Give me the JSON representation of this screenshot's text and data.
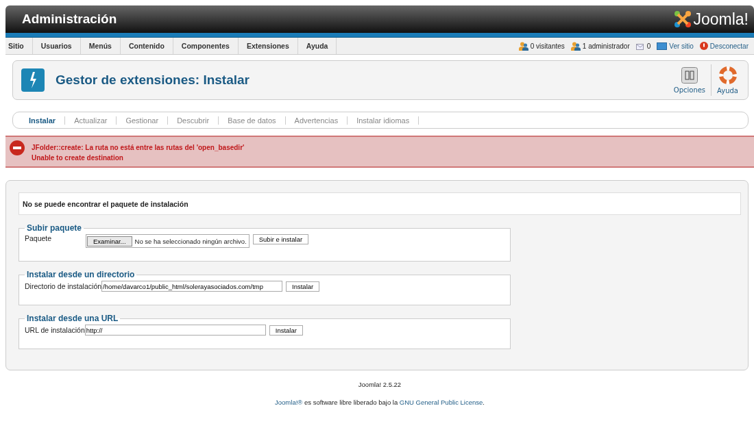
{
  "header": {
    "title": "Administración",
    "logo": "Joomla!"
  },
  "menu": [
    "Sitio",
    "Usuarios",
    "Menús",
    "Contenido",
    "Componentes",
    "Extensiones",
    "Ayuda"
  ],
  "status": [
    {
      "kind": "text",
      "label": "0 visitantes"
    },
    {
      "kind": "text",
      "label": "1 administrador"
    },
    {
      "kind": "text",
      "label": "0"
    },
    {
      "kind": "link",
      "label": "Ver sitio"
    },
    {
      "kind": "link",
      "label": "Desconectar"
    }
  ],
  "toolbar": {
    "title": "Gestor de extensiones: Instalar",
    "buttons": [
      "Opciones",
      "Ayuda"
    ]
  },
  "subtabs": [
    {
      "label": "Instalar",
      "selected": true
    },
    {
      "label": "Actualizar",
      "selected": false
    },
    {
      "label": "Gestionar",
      "selected": false
    },
    {
      "label": "Descubrir",
      "selected": false
    },
    {
      "label": "Base de datos",
      "selected": false
    },
    {
      "label": "Advertencias",
      "selected": false
    },
    {
      "label": "Instalar idiomas",
      "selected": false
    }
  ],
  "error": [
    "JFolder::create: La ruta no está entre las rutas del 'open_basedir'",
    "Unable to create destination"
  ],
  "notice": "No se puede encontrar el paquete de instalación",
  "upload": {
    "legend": "Subir paquete",
    "label": "Paquete",
    "browse": "Examinar...",
    "file_status": "No se ha seleccionado ningún archivo.",
    "button": "Subir e instalar"
  },
  "directory": {
    "legend": "Instalar desde un directorio",
    "label": "Directorio de instalación",
    "value": "/home/davarco1/public_html/solerayasociados.com/tmp",
    "button": "Instalar"
  },
  "url": {
    "legend": "Instalar desde una URL",
    "label": "URL de instalación",
    "value": "http://",
    "button": "Instalar"
  },
  "footer": {
    "version": "Joomla! 2.5.22",
    "link_1": "Joomla!®",
    "text": "es software libre liberado bajo la",
    "link_2": "GNU General Public License",
    "end": "."
  }
}
